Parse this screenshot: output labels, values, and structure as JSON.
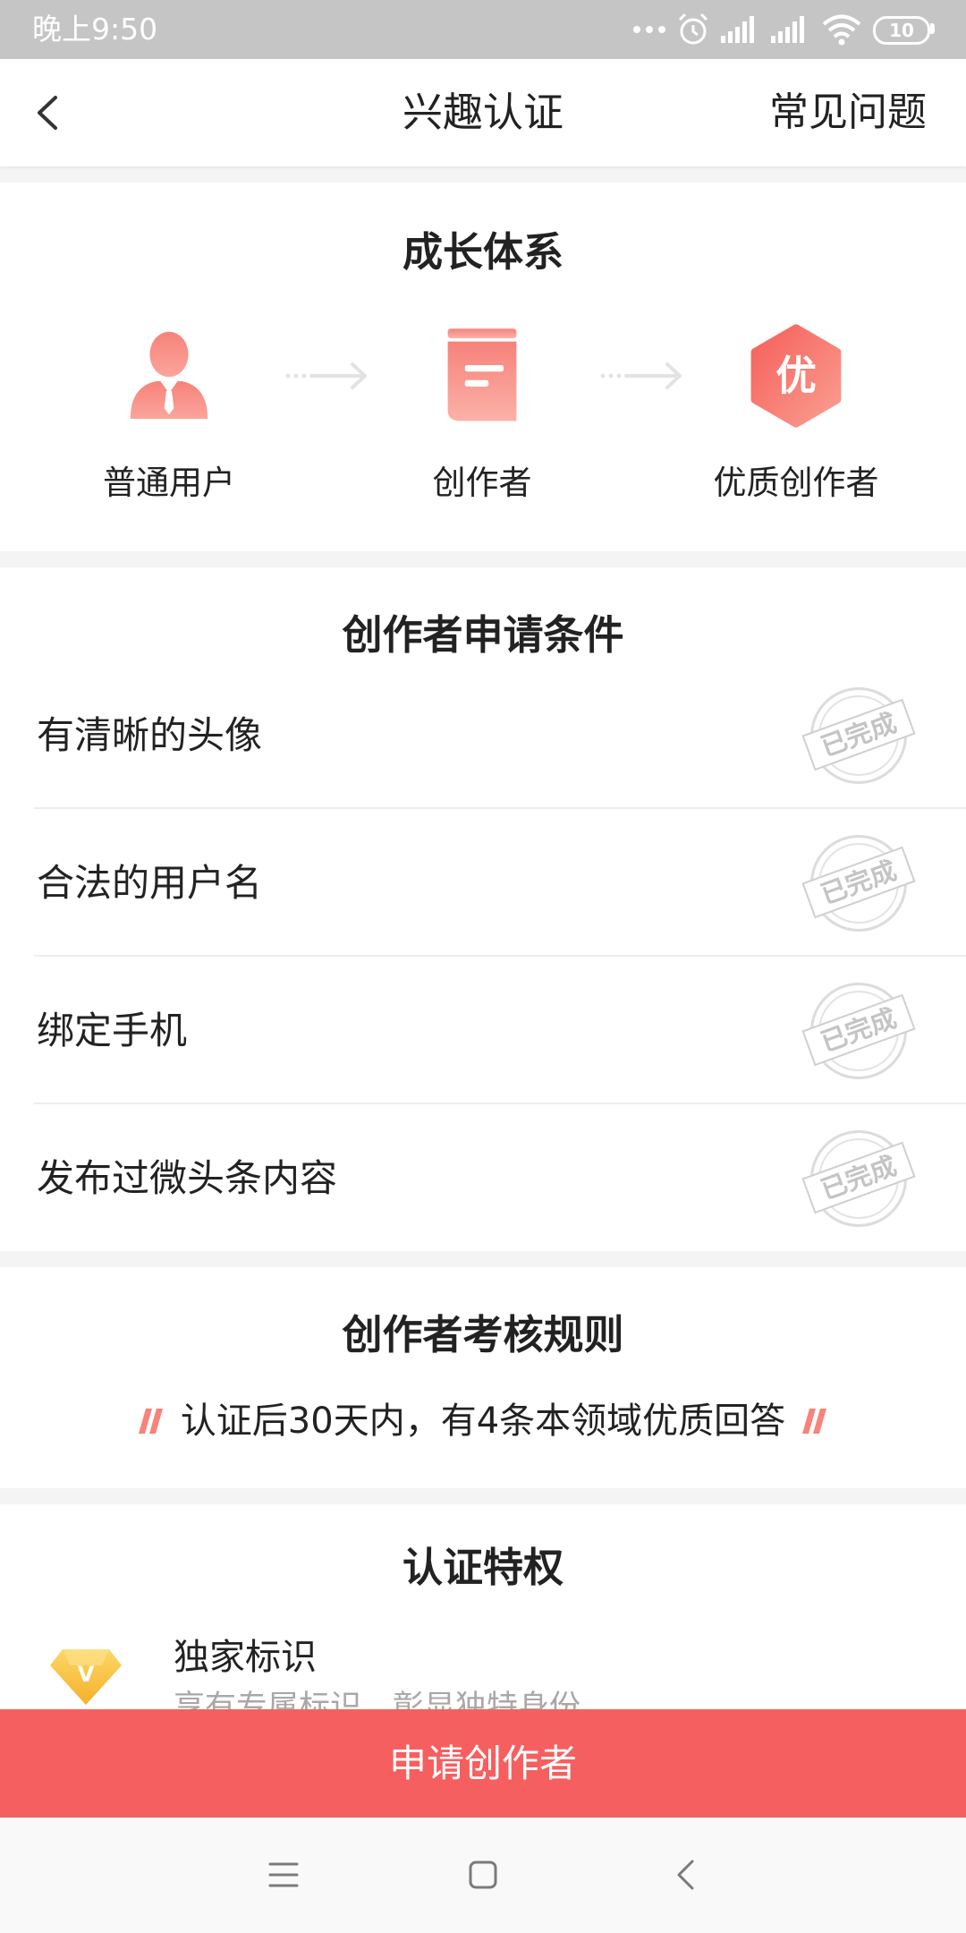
{
  "status_bar": {
    "time": "晚上9:50",
    "battery_level": "10",
    "icons": [
      "more-dots-icon",
      "alarm-icon",
      "signal-icon",
      "signal-icon",
      "wifi-icon",
      "battery-icon"
    ]
  },
  "header": {
    "back_icon": "back-chevron-icon",
    "title": "兴趣认证",
    "faq_label": "常见问题"
  },
  "growth": {
    "title": "成长体系",
    "stages": [
      {
        "label": "普通用户",
        "icon": "user-icon"
      },
      {
        "label": "创作者",
        "icon": "document-icon"
      },
      {
        "label": "优质创作者",
        "icon": "quality-badge-icon",
        "badge_text": "优"
      }
    ],
    "connector_icon": "arrow-right-icon"
  },
  "conditions": {
    "title": "创作者申请条件",
    "items": [
      {
        "label": "有清晰的头像",
        "status": "已完成"
      },
      {
        "label": "合法的用户名",
        "status": "已完成"
      },
      {
        "label": "绑定手机",
        "status": "已完成"
      },
      {
        "label": "发布过微头条内容",
        "status": "已完成"
      }
    ]
  },
  "rules": {
    "title": "创作者考核规则",
    "text": "认证后30天内，有4条本领域优质回答"
  },
  "privileges": {
    "title": "认证特权",
    "items": [
      {
        "title": "独家标识",
        "desc": "享有专属标识，彰显独特身份",
        "icon": "diamond-icon",
        "badge_text": "V"
      }
    ]
  },
  "apply_button": {
    "label": "申请创作者"
  },
  "nav_bar": {
    "icons": [
      "menu-icon",
      "home-icon",
      "back-icon"
    ]
  },
  "colors": {
    "accent": "#f65f5f",
    "icon_gradient_start": "#f6827a",
    "icon_gradient_end": "#fba59c",
    "page_bg": "#f4f4f4",
    "status_bar_bg": "#c5c5c5",
    "text": "#222222",
    "stamp": "#cfcfcf"
  }
}
